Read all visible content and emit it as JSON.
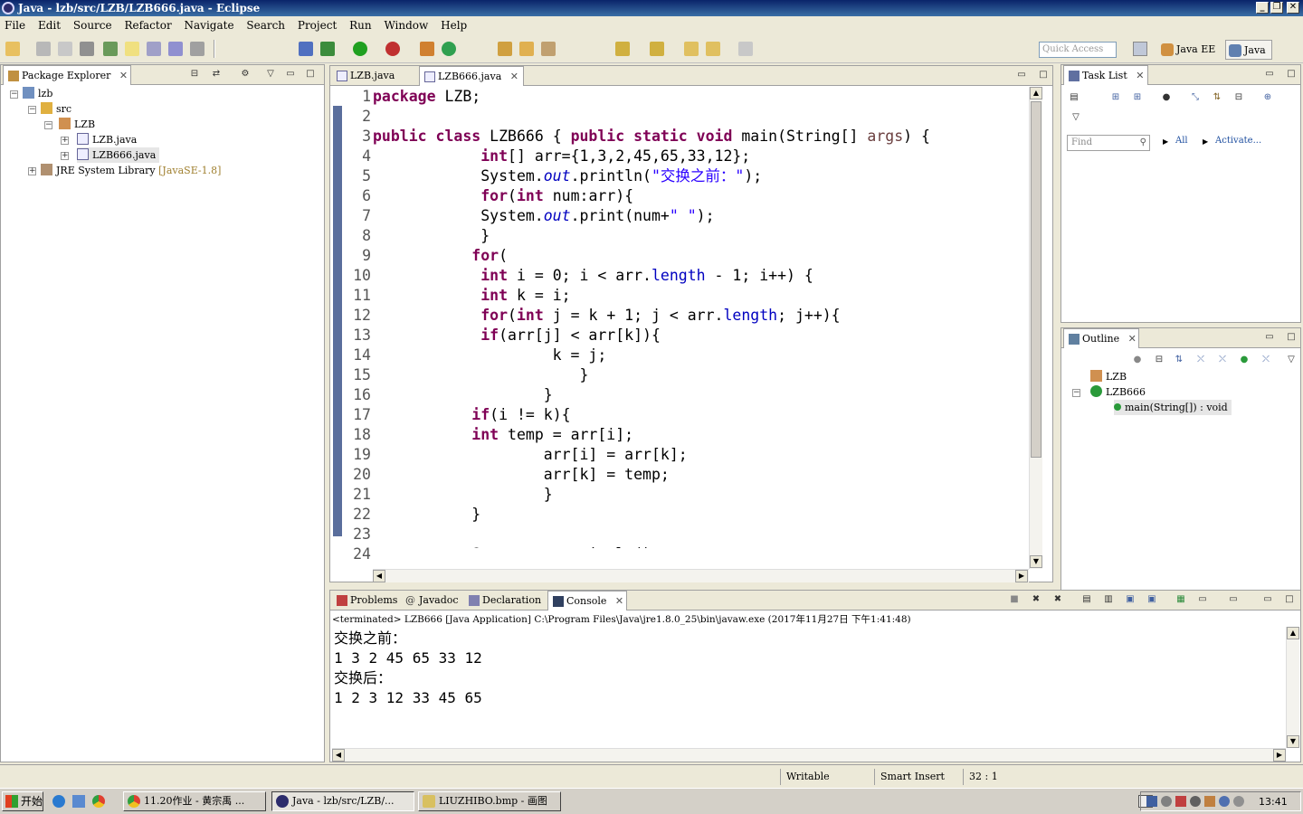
{
  "window": {
    "title": "Java - lzb/src/LZB/LZB666.java - Eclipse"
  },
  "menu": [
    "File",
    "Edit",
    "Source",
    "Refactor",
    "Navigate",
    "Search",
    "Project",
    "Run",
    "Window",
    "Help"
  ],
  "toolbar": {
    "quick_access_placeholder": "Quick Access",
    "perspectives": [
      "Java EE",
      "Java"
    ]
  },
  "package_explorer": {
    "tab_label": "Package Explorer",
    "tree": [
      {
        "label": "lzb",
        "icon": "project-icon"
      },
      {
        "label": "src",
        "icon": "source-folder-icon"
      },
      {
        "label": "LZB",
        "icon": "package-icon"
      },
      {
        "label": "LZB.java",
        "icon": "java-file-icon"
      },
      {
        "label": "LZB666.java",
        "icon": "java-file-icon",
        "selected": true
      },
      {
        "label": "JRE System Library",
        "decoration": "[JavaSE-1.8]",
        "icon": "library-icon"
      }
    ]
  },
  "editor": {
    "tabs": [
      {
        "label": "LZB.java",
        "active": false
      },
      {
        "label": "LZB666.java",
        "active": true
      }
    ],
    "line_numbers": [
      "1",
      "2",
      "3",
      "4",
      "5",
      "6",
      "7",
      "8",
      "9",
      "10",
      "11",
      "12",
      "13",
      "14",
      "15",
      "16",
      "17",
      "18",
      "19",
      "20",
      "21",
      "22",
      "23",
      "24"
    ],
    "lines": [
      "package LZB;",
      "",
      "public class LZB666 { public static void main(String[] args) {",
      "            int[] arr={1,3,2,45,65,33,12};",
      "            System.out.println(\"交换之前：\");",
      "            for(int num:arr){",
      "            System.out.print(num+\" \");",
      "            }",
      "           for(",
      "            int i = 0; i < arr.length - 1; i++) {",
      "            int k = i;",
      "            for(int j = k + 1; j < arr.length; j++){",
      "            if(arr[j] < arr[k]){",
      "                    k = j;",
      "                       }",
      "                   }",
      "           if(i != k){",
      "           int temp = arr[i];",
      "                   arr[i] = arr[k];",
      "                   arr[k] = temp;",
      "                   }",
      "           }",
      "",
      "           System.out.println();"
    ]
  },
  "task_list": {
    "tab_label": "Task List",
    "find_placeholder": "Find",
    "all_label": "All",
    "activate_label": "Activate..."
  },
  "outline": {
    "tab_label": "Outline",
    "items": [
      {
        "label": "LZB"
      },
      {
        "label": "LZB666"
      },
      {
        "label": "main(String[]) : void"
      }
    ]
  },
  "bottom_panel": {
    "tabs": [
      "Problems",
      "Javadoc",
      "Declaration",
      "Console"
    ],
    "active_tab": "Console",
    "terminated": "<terminated> LZB666 [Java Application] C:\\Program Files\\Java\\jre1.8.0_25\\bin\\javaw.exe (2017年11月27日 下午1:41:48)",
    "output": [
      "交换之前：",
      "1 3 2 45 65 33 12",
      "交换后：",
      "1 2 3 12 33 45 65"
    ]
  },
  "status": {
    "writable": "Writable",
    "insert_mode": "Smart Insert",
    "position": "32 : 1"
  },
  "taskbar": {
    "start": "开始",
    "buttons": [
      "11.20作业 - 黄宗禹 ...",
      "Java - lzb/src/LZB/...",
      "LIUZHIBO.bmp - 画图"
    ],
    "clock": "13:41"
  }
}
